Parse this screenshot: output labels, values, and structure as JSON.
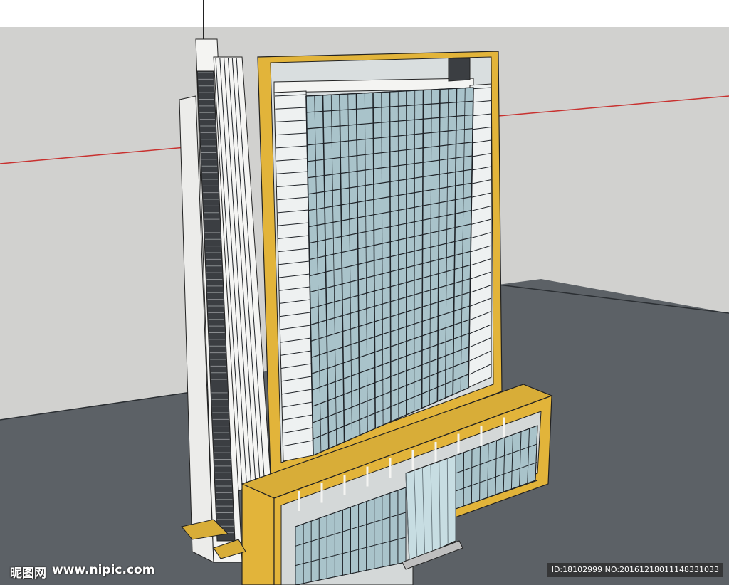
{
  "scene": {
    "sky_color": "#d1d1cf",
    "ground_color": "#5c6166",
    "axis_color": "#c8312f",
    "facade_yellow": "#e2b43a",
    "glass_color": "#a9c3ca",
    "wall_white": "#f4f4f2",
    "mullion_color": "#1f2328"
  },
  "watermark": {
    "brand": "昵图网",
    "site": "www.nipic.com",
    "id_text": "ID:18102999 NO:20161218011148331033"
  }
}
